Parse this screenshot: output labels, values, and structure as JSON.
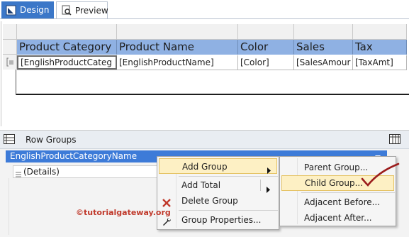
{
  "tabs": [
    {
      "label": "Design",
      "icon": "design-icon",
      "active": true
    },
    {
      "label": "Preview",
      "icon": "preview-icon",
      "active": false
    }
  ],
  "table": {
    "headers": [
      "Product Category",
      "Product Name",
      "Color",
      "Sales",
      "Tax"
    ],
    "cells": [
      "[EnglishProductCateg",
      "[EnglishProductName]",
      "[Color]",
      "[SalesAmour",
      "[TaxAmt]"
    ]
  },
  "grouping": {
    "title": "Row Groups",
    "selected_group": "EnglishProductCategoryName",
    "details": "(Details)"
  },
  "context_menu": {
    "items": [
      {
        "label": "Add Group",
        "icon": "",
        "submenu": true
      },
      {
        "label": "Add Total",
        "icon": "",
        "submenu": true
      },
      {
        "label": "Delete Group",
        "icon": "delete-x-icon",
        "submenu": false
      },
      {
        "label": "Group Properties...",
        "icon": "properties-wrench-icon",
        "submenu": false
      }
    ]
  },
  "submenu": {
    "items": [
      "Parent Group...",
      "Child Group...",
      "Adjacent Before...",
      "Adjacent After..."
    ],
    "highlighted": "Child Group..."
  },
  "watermark": "©tutorialgateway.org",
  "colors": {
    "accent": "#3b77c8",
    "header_fill": "#8fb1e3",
    "menu_highlight": "#fdf0c4",
    "annotation_check": "#9b1c1c",
    "delete_x": "#c0392b"
  }
}
